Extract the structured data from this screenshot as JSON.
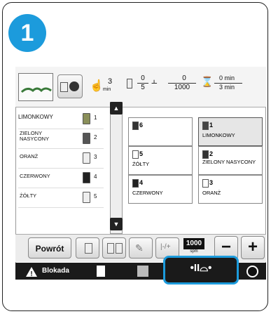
{
  "step_number": "1",
  "status": {
    "speed_value": "3",
    "speed_unit": "min",
    "color_count_current": "0",
    "color_count_total": "5",
    "stitch_current": "0",
    "stitch_total": "1000",
    "time_current": "0 min",
    "time_total": "3 min"
  },
  "color_list": [
    {
      "label": "LIMONKOWY",
      "num": "1",
      "color": "#9aa06a",
      "selected": true
    },
    {
      "label": "ZIELONY NASYCONY",
      "num": "2",
      "color": "#2e6e3a"
    },
    {
      "label": "ORANŻ",
      "num": "3",
      "color": "#e8e8e8"
    },
    {
      "label": "CZERWONY",
      "num": "4",
      "color": "#222222"
    },
    {
      "label": "ŻÓŁTY",
      "num": "5",
      "color": "#e8e8e8"
    }
  ],
  "spools": [
    {
      "num": "6",
      "name": "",
      "color": "#333333"
    },
    {
      "num": "1",
      "name": "LIMONKOWY",
      "color": "#444444",
      "selected": true
    },
    {
      "num": "5",
      "name": "ŻÓŁTY",
      "color": "#ffffff"
    },
    {
      "num": "2",
      "name": "ZIELONY NASYCONY",
      "color": "#333333"
    },
    {
      "num": "4",
      "name": "CZERWONY",
      "color": "#222222"
    },
    {
      "num": "3",
      "name": "ORANŻ",
      "color": "#ffffff"
    }
  ],
  "toolbar": {
    "back_label": "Powrót",
    "stitch_value": "1000",
    "stitch_unit": "spm",
    "minus_label": "−",
    "plus_label": "+"
  },
  "bottom": {
    "lock_label": "Blokada",
    "move_label": "•ΙΙ⌓•"
  },
  "colors": {
    "accent": "#1c9bdc"
  }
}
